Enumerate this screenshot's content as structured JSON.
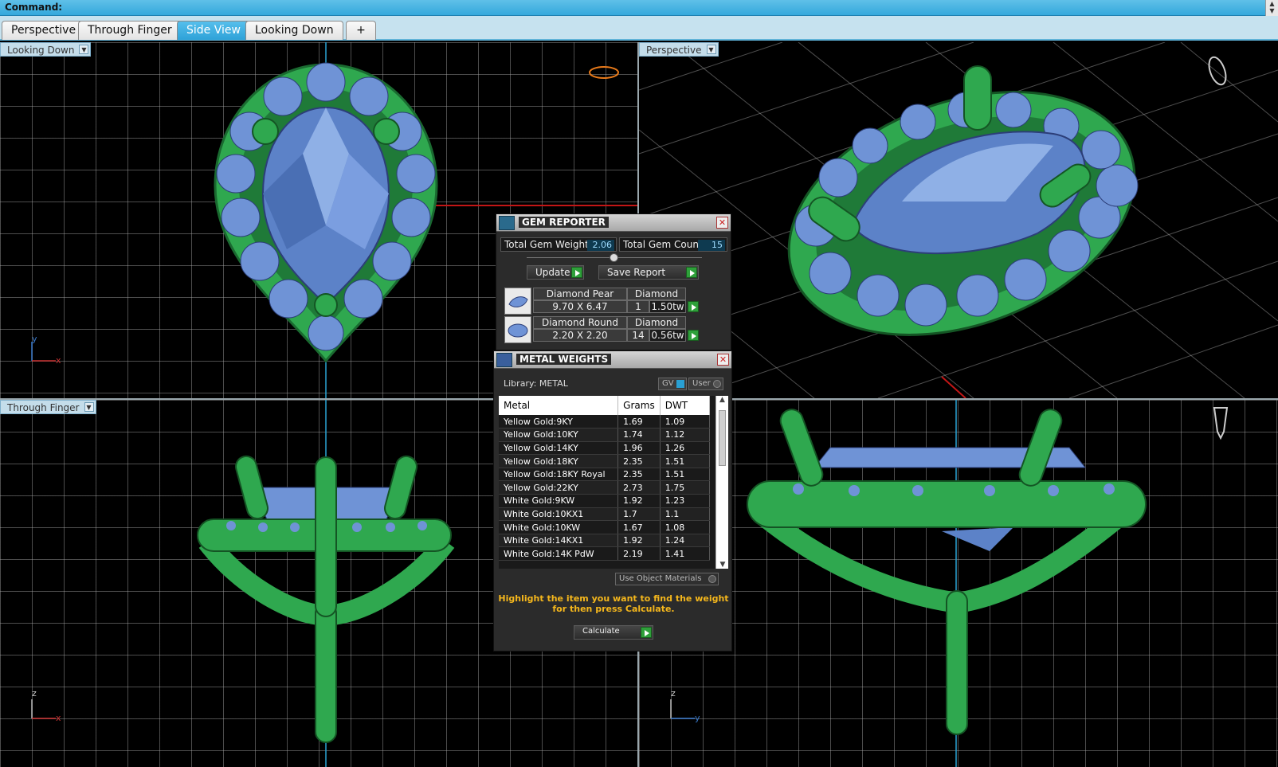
{
  "command_bar": {
    "label": "Command:"
  },
  "tabs": [
    {
      "label": "Perspective"
    },
    {
      "label": "Through Finger"
    },
    {
      "label": "Side View"
    },
    {
      "label": "Looking Down"
    },
    {
      "label": "+"
    }
  ],
  "active_tab": "Side View",
  "viewports": {
    "top_left": {
      "label": "Looking Down",
      "axis_a": "y",
      "axis_b": "x"
    },
    "top_right": {
      "label": "Perspective"
    },
    "bottom_left": {
      "label": "Through Finger",
      "axis_a": "z",
      "axis_b": "x"
    },
    "bottom_right": {
      "label": "",
      "axis_a": "z",
      "axis_b": "y"
    }
  },
  "colors": {
    "accent": "#34a8dc",
    "metal": "#2fa84f",
    "gem": "#6f93d6",
    "warning_text": "#f5b71c"
  },
  "gem_reporter": {
    "title": "GEM REPORTER",
    "total_weight_label": "Total Gem Weight",
    "total_weight_value": "2.06",
    "total_count_label": "Total Gem Count",
    "total_count_value": "15",
    "update_label": "Update",
    "save_label": "Save Report",
    "gems": [
      {
        "shape": "Diamond Pear",
        "material": "Diamond",
        "size": "9.70 X 6.47",
        "count": "1",
        "weight": "1.50tw"
      },
      {
        "shape": "Diamond Round",
        "material": "Diamond",
        "size": "2.20 X 2.20",
        "count": "14",
        "weight": "0.56tw"
      }
    ]
  },
  "metal_weights": {
    "title": "METAL WEIGHTS",
    "library_label": "Library: METAL",
    "gv_label": "GV",
    "user_label": "User",
    "columns": [
      "Metal",
      "Grams",
      "DWT"
    ],
    "rows": [
      [
        "Yellow Gold:9KY",
        "1.69",
        "1.09"
      ],
      [
        "Yellow Gold:10KY",
        "1.74",
        "1.12"
      ],
      [
        "Yellow Gold:14KY",
        "1.96",
        "1.26"
      ],
      [
        "Yellow Gold:18KY",
        "2.35",
        "1.51"
      ],
      [
        "Yellow Gold:18KY Royal",
        "2.35",
        "1.51"
      ],
      [
        "Yellow Gold:22KY",
        "2.73",
        "1.75"
      ],
      [
        "White Gold:9KW",
        "1.92",
        "1.23"
      ],
      [
        "White Gold:10KX1",
        "1.7",
        "1.1"
      ],
      [
        "White Gold:10KW",
        "1.67",
        "1.08"
      ],
      [
        "White Gold:14KX1",
        "1.92",
        "1.24"
      ],
      [
        "White Gold:14K PdW",
        "2.19",
        "1.41"
      ]
    ],
    "use_object_materials": "Use Object Materials",
    "hint": "Highlight the item you want to find the weight for then press Calculate.",
    "calculate_label": "Calculate"
  }
}
